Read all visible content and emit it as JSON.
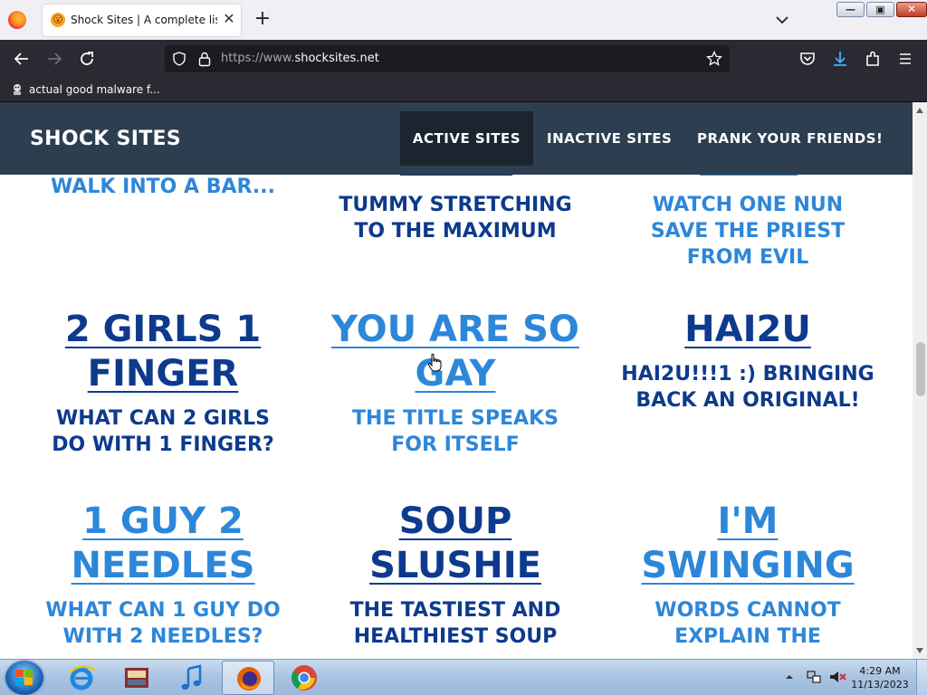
{
  "browser": {
    "tab": {
      "favicon": "😮",
      "title": "Shock Sites | A complete list of",
      "close_glyph": "✕"
    },
    "new_tab_glyph": "+",
    "window_buttons": {
      "minimize": "—",
      "maximize": "▣",
      "close": "✕"
    },
    "url": {
      "scheme": "https://www.",
      "domain": "shocksites.net"
    },
    "bookmarks": [
      {
        "label": "actual good malware f..."
      }
    ]
  },
  "site": {
    "brand": "SHOCK SITES",
    "nav": [
      {
        "label": "ACTIVE SITES",
        "active": true
      },
      {
        "label": "INACTIVE SITES",
        "active": false
      },
      {
        "label": "PRANK YOUR FRIENDS!",
        "active": false
      }
    ],
    "top_fragments": {
      "left": "WALK INTO A BAR...",
      "middle": [
        "TUMMY STRETCHING",
        "TO THE MAXIMUM"
      ],
      "right": [
        "WATCH ONE NUN",
        "SAVE THE PRIEST",
        "FROM EVIL"
      ]
    },
    "cards": [
      {
        "title": [
          "2 GIRLS 1",
          "FINGER"
        ],
        "desc": [
          "WHAT CAN 2 GIRLS",
          "DO WITH 1 FINGER?"
        ],
        "tone": "dark"
      },
      {
        "title": [
          "YOU ARE SO",
          "GAY"
        ],
        "desc": [
          "THE TITLE SPEAKS",
          "FOR ITSELF"
        ],
        "tone": "light"
      },
      {
        "title": [
          "HAI2U"
        ],
        "desc": [
          "HAI2U!!!1 :) BRINGING",
          "BACK AN ORIGINAL!"
        ],
        "tone": "dark"
      },
      {
        "title": [
          "1 GUY 2",
          "NEEDLES"
        ],
        "desc": [
          "WHAT CAN 1 GUY DO",
          "WITH 2 NEEDLES?"
        ],
        "tone": "light"
      },
      {
        "title": [
          "SOUP",
          "SLUSHIE"
        ],
        "desc": [
          "THE TASTIEST AND",
          "HEALTHIEST SOUP"
        ],
        "tone": "dark"
      },
      {
        "title": [
          "I'M",
          "SWINGING"
        ],
        "desc": [
          "WORDS CANNOT",
          "EXPLAIN THE"
        ],
        "tone": "light"
      }
    ],
    "colors": {
      "nav_bg": "#2c3e50",
      "nav_active_bg": "#1a252f",
      "dark_link": "#0d3a8c",
      "light_link": "#2d87d9"
    }
  },
  "taskbar": {
    "apps": [
      {
        "name": "internet-explorer"
      },
      {
        "name": "media-center"
      },
      {
        "name": "itunes"
      },
      {
        "name": "firefox",
        "active": true
      },
      {
        "name": "chrome"
      }
    ],
    "clock": {
      "time": "4:29 AM",
      "date": "11/13/2023"
    }
  }
}
